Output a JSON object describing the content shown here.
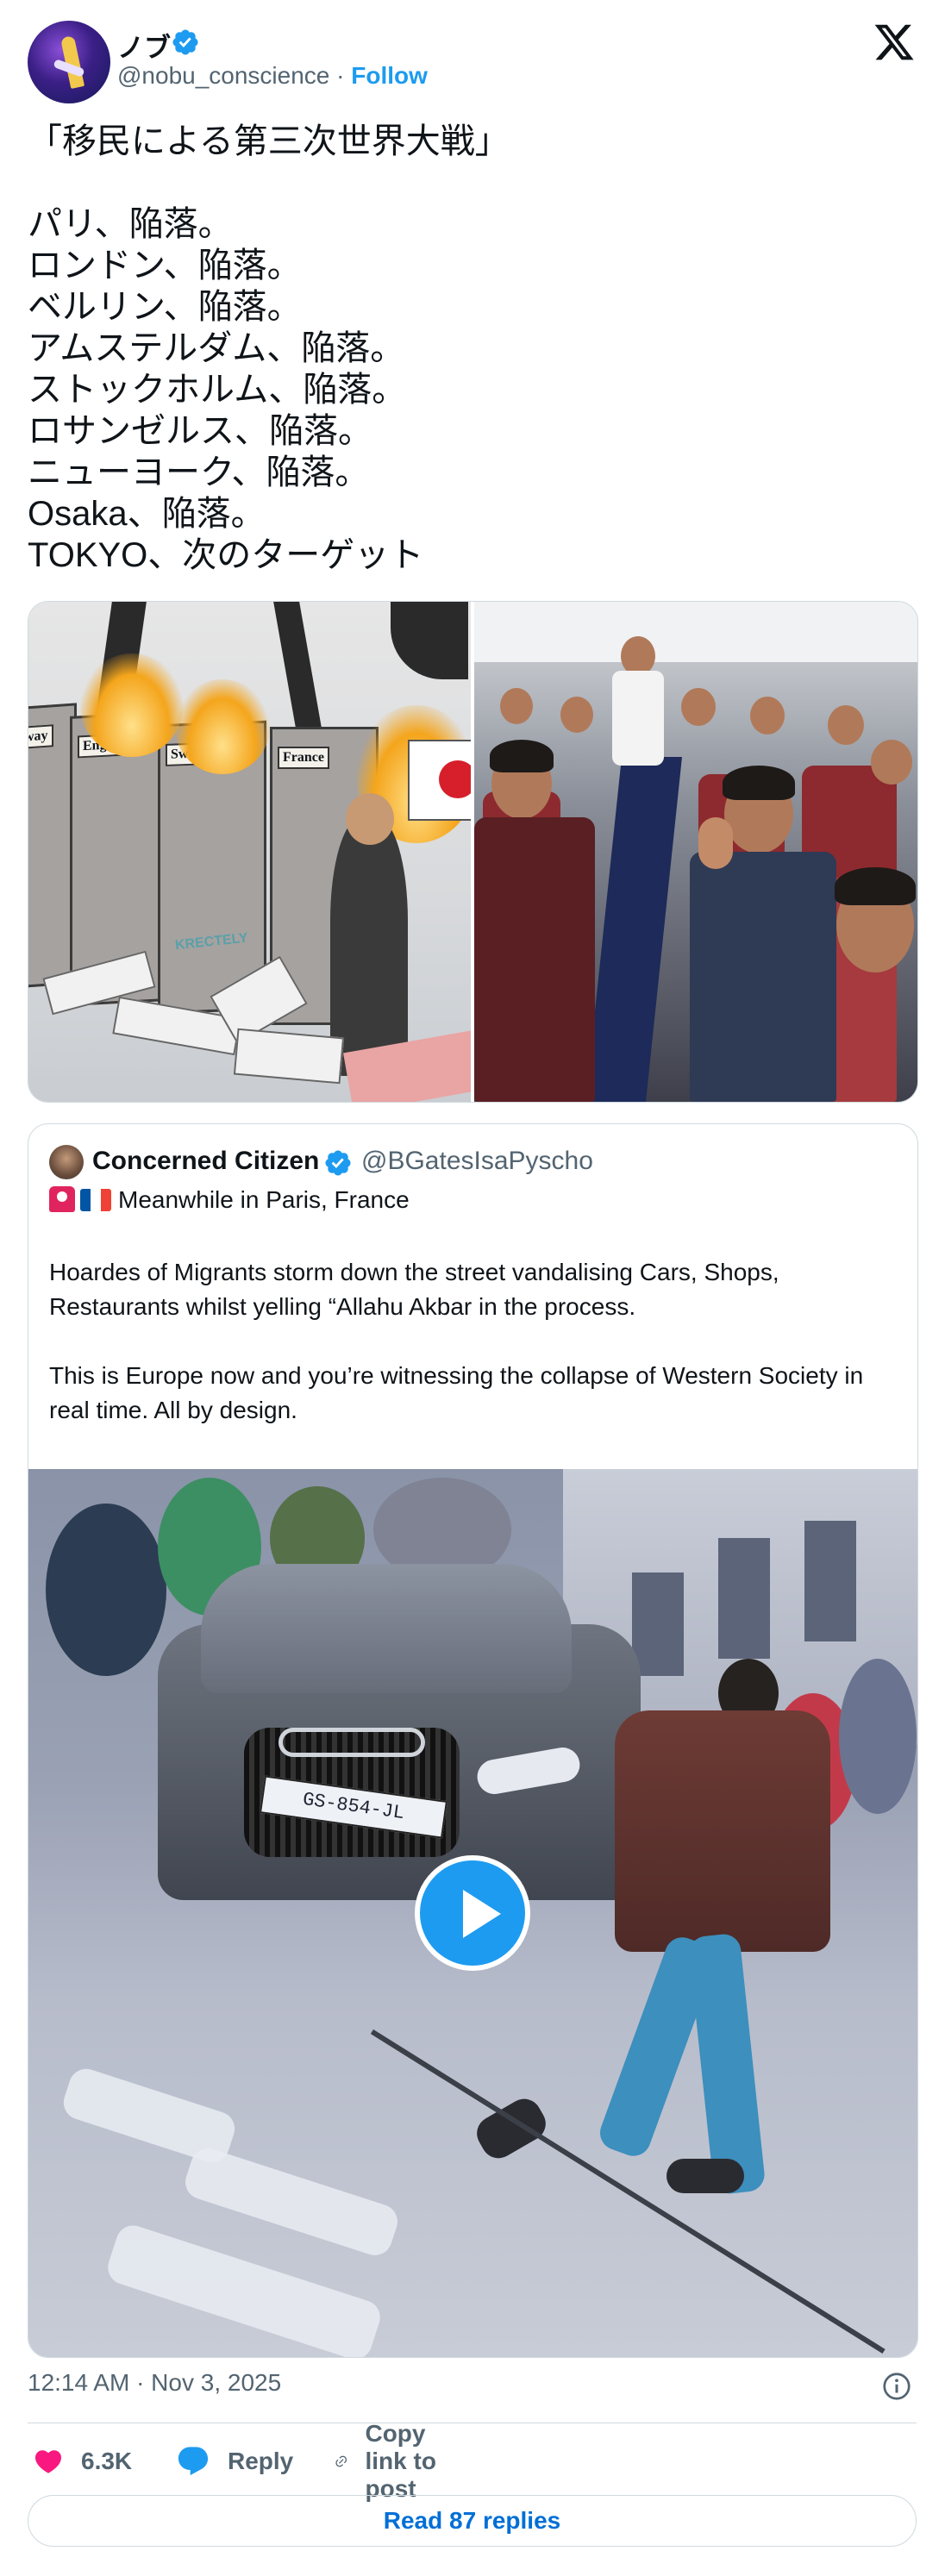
{
  "author": {
    "name": "ノブ",
    "handle": "@nobu_conscience",
    "separator": "·",
    "follow_label": "Follow"
  },
  "post": {
    "text": "「移民による第三次世界大戦」\n\nパリ、陥落。\nロンドン、陥落。\nベルリン、陥落。\nアムステルダム、陥落。\nストックホルム、陥落。\nロサンゼルス、陥落。\nニューヨーク、陥落。\nOsaka、陥落。\nTOKYO、次のターゲット",
    "cartoon_labels": {
      "door1": "way",
      "door2": "England",
      "door3": "Sweden",
      "door4": "France",
      "signature": "KRECTELY"
    },
    "timestamp": "12:14 AM · Nov 3, 2025"
  },
  "quote": {
    "name": "Concerned Citizen",
    "handle": "@BGatesIsaPyscho",
    "first_line": "Meanwhile in Paris, France",
    "body": "Hoardes of Migrants storm down the street vandalising Cars, Shops, Restaurants whilst yelling “Allahu Akbar in the process.\n\nThis is Europe now and you’re witnessing the collapse of Western Society in real time.  All by design.",
    "plate_text": "GS-854-JL"
  },
  "actions": {
    "likes": "6.3K",
    "reply_label": "Reply",
    "copy_label": "Copy link to post",
    "read_replies_label": "Read 87 replies"
  },
  "colors": {
    "accent": "#1d9bf0",
    "like": "#f91880",
    "text": "#0f1419",
    "muted": "#536471",
    "border": "#cfd9de"
  },
  "icons": [
    "verified-badge-icon",
    "x-logo-icon",
    "info-icon",
    "heart-icon",
    "reply-bubble-icon",
    "link-icon",
    "play-icon",
    "siren-emoji-icon",
    "france-flag-icon"
  ]
}
